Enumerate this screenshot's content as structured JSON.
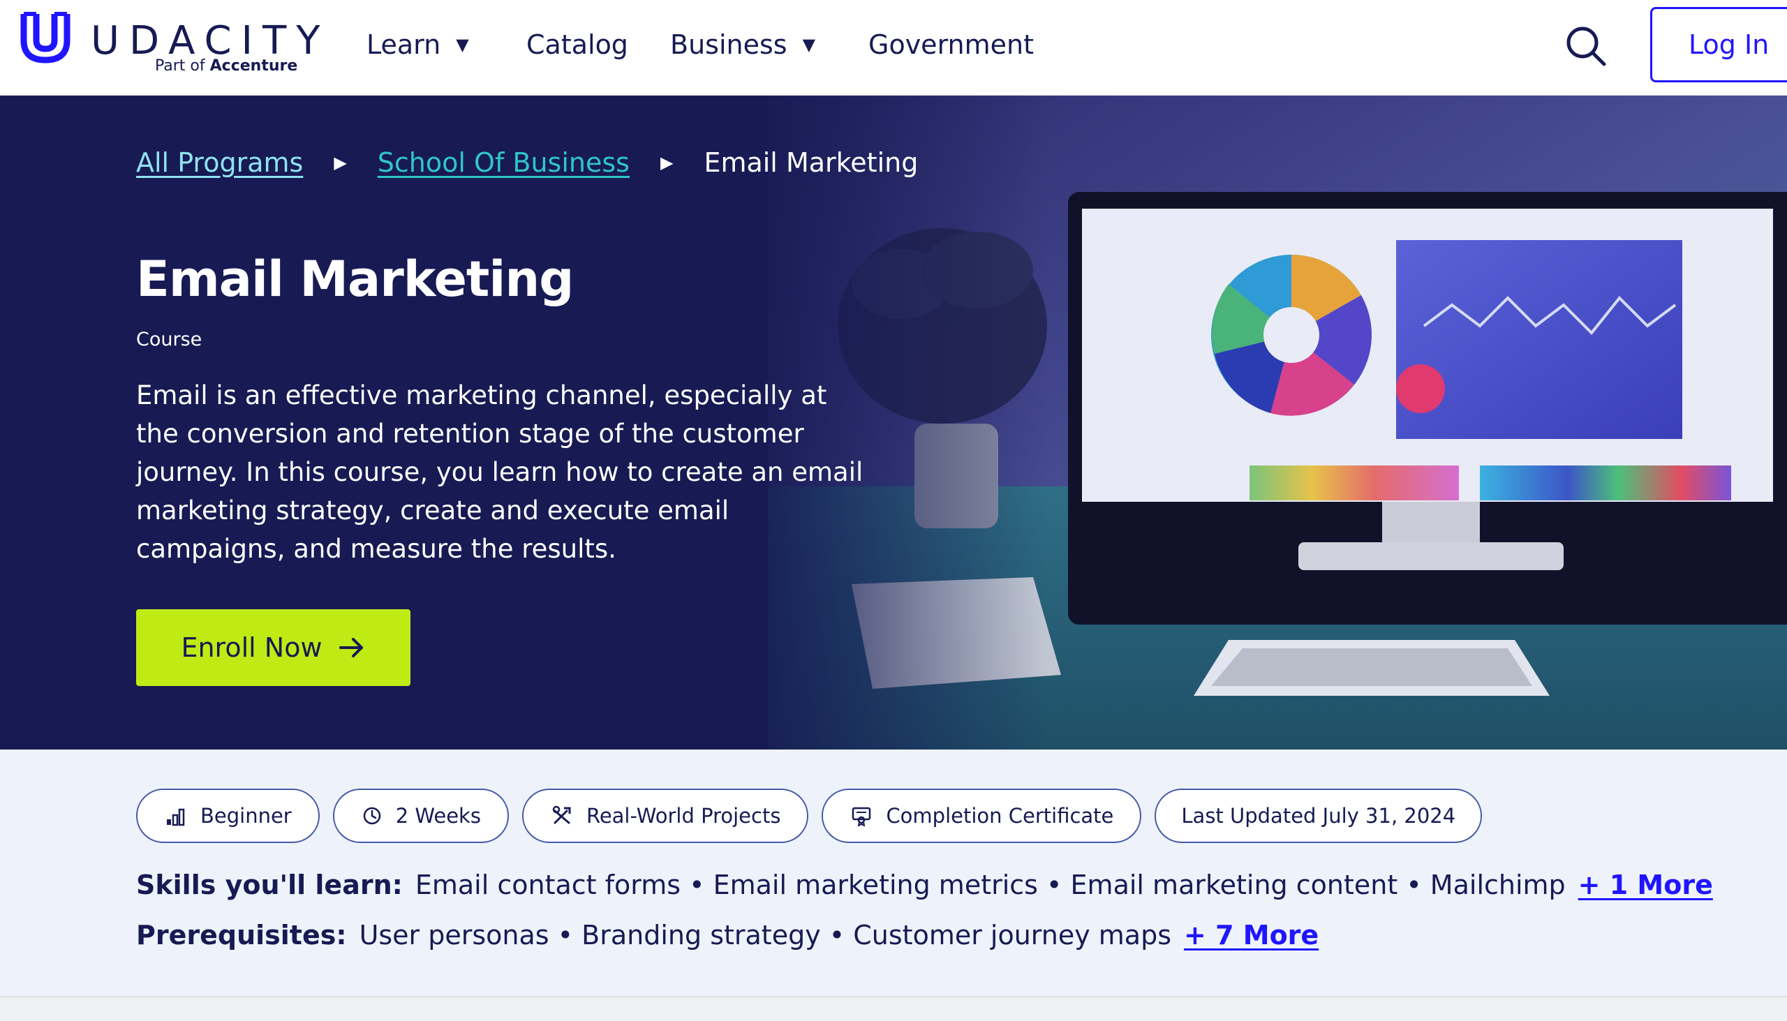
{
  "brand": {
    "name": "UDACITY",
    "sub_prefix": "Part of",
    "sub_bold": "Accenture",
    "color": "#2015ff"
  },
  "nav": {
    "learn": "Learn",
    "catalog": "Catalog",
    "business": "Business",
    "government": "Government",
    "login": "Log In"
  },
  "breadcrumb": {
    "all_programs": "All Programs",
    "school": "School Of Business",
    "current": "Email Marketing"
  },
  "hero": {
    "title": "Email Marketing",
    "kind": "Course",
    "description": "Email is an effective marketing channel, especially at the conversion and retention stage of the customer journey. In this course, you learn how to create an email marketing strategy, create and execute email campaigns, and measure the results.",
    "enroll": "Enroll Now",
    "background": "#171a53",
    "cta_color": "#c0ea13"
  },
  "tags": {
    "level": "Beginner",
    "duration": "2 Weeks",
    "projects": "Real-World Projects",
    "certificate": "Completion Certificate",
    "updated": "Last Updated July 31, 2024"
  },
  "skills": {
    "label": "Skills you'll learn:",
    "items": "Email contact forms • Email marketing metrics • Email marketing content • Mailchimp",
    "more": "+ 1 More"
  },
  "prerequisites": {
    "label": "Prerequisites:",
    "items": "User personas • Branding strategy • Customer journey maps",
    "more": "+ 7 More"
  }
}
